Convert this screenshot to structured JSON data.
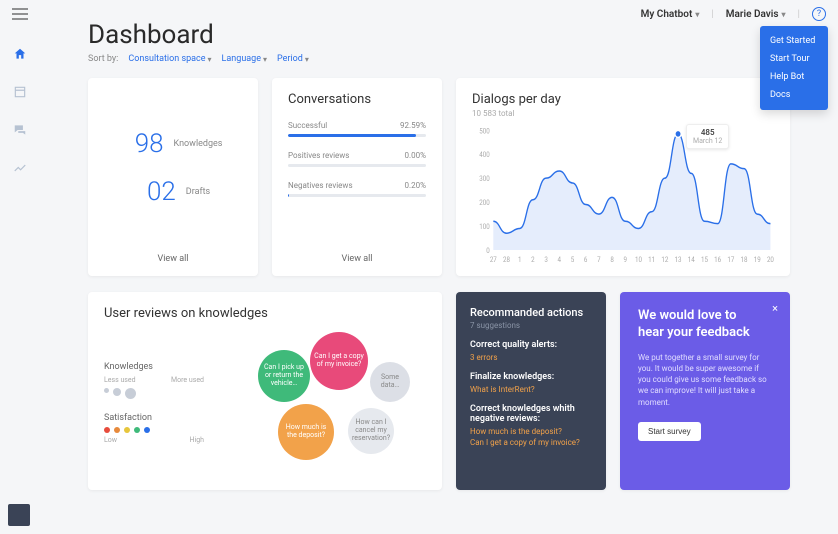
{
  "topbar": {
    "bot_selector": "My Chatbot",
    "user_name": "Marie Davis"
  },
  "help_menu": {
    "items": [
      "Get Started",
      "Start Tour",
      "Help Bot",
      "Docs"
    ]
  },
  "page": {
    "title": "Dashboard",
    "sort_label": "Sort by:",
    "filters": [
      "Consultation space",
      "Language",
      "Period"
    ]
  },
  "kpi": {
    "items": [
      {
        "value": "98",
        "label": "Knowledges"
      },
      {
        "value": "02",
        "label": "Drafts"
      }
    ],
    "view_all": "View all"
  },
  "conversations": {
    "title": "Conversations",
    "rows": [
      {
        "label": "Successful",
        "pct": "92.59%",
        "fill": 92.6
      },
      {
        "label": "Positives reviews",
        "pct": "0.00%",
        "fill": 0
      },
      {
        "label": "Negatives reviews",
        "pct": "0.20%",
        "fill": 0.2
      }
    ],
    "view_all": "View all"
  },
  "dialogs": {
    "title": "Dialogs per day",
    "subtitle": "10 583 total",
    "tooltip_value": "485",
    "tooltip_date": "March 12",
    "chart_data": {
      "type": "area",
      "x": [
        "27",
        "28",
        "1",
        "2",
        "3",
        "4",
        "5",
        "6",
        "7",
        "8",
        "9",
        "10",
        "11",
        "12",
        "13",
        "14",
        "15",
        "16",
        "17",
        "18",
        "19",
        "20"
      ],
      "values": [
        120,
        70,
        90,
        210,
        300,
        330,
        280,
        190,
        150,
        220,
        120,
        90,
        160,
        300,
        485,
        320,
        120,
        110,
        360,
        340,
        150,
        110
      ],
      "ylim": [
        0,
        500
      ],
      "yticks": [
        0,
        100,
        200,
        300,
        400,
        500
      ],
      "highlight_index": 14
    }
  },
  "reviews": {
    "title": "User reviews on knowledges",
    "knowledges_label": "Knowledges",
    "knowledges_low": "Less used",
    "knowledges_high": "More used",
    "satisfaction_label": "Satisfaction",
    "sat_low": "Low",
    "sat_high": "High",
    "sat_colors": [
      "#e74c3c",
      "#e78a3c",
      "#e7c63c",
      "#3fba7a",
      "#2a6fe8"
    ],
    "bubbles": [
      {
        "text": "Can I pick up or return the vehicle…",
        "color": "#3fba7a",
        "size": 52,
        "x": 10,
        "y": 28
      },
      {
        "text": "Can I get a copy of my invoice?",
        "color": "#e84a7a",
        "size": 58,
        "x": 62,
        "y": 10
      },
      {
        "text": "Some data…",
        "color": "#dcdfe6",
        "textColor": "#888",
        "size": 40,
        "x": 122,
        "y": 40
      },
      {
        "text": "How much is the deposit?",
        "color": "#f2a24a",
        "size": 56,
        "x": 30,
        "y": 82
      },
      {
        "text": "How can I cancel my reservation?",
        "color": "#e6e9ee",
        "textColor": "#888",
        "size": 46,
        "x": 100,
        "y": 86
      }
    ]
  },
  "actions": {
    "title": "Recommanded actions",
    "subtitle": "7 suggestions",
    "groups": [
      {
        "title": "Correct quality alerts:",
        "links": [
          "3 errors"
        ]
      },
      {
        "title": "Finalize knowledges:",
        "links": [
          "What is InterRent?"
        ]
      },
      {
        "title": "Correct knowledges whith negative reviews:",
        "links": [
          "How much is the deposit?",
          "Can I get a copy of my invoice?"
        ]
      }
    ]
  },
  "feedback": {
    "title": "We would love to hear your feedback",
    "body": "We put together a small survey for you. It would be super awesome if you could give us some feedback so we can improve! It will just take a moment.",
    "button": "Start survey"
  }
}
